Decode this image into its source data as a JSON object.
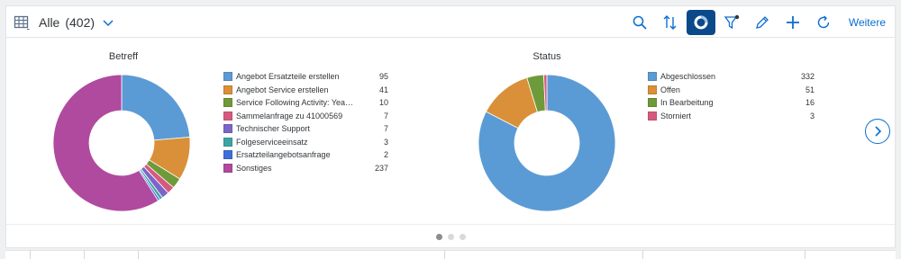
{
  "toolbar": {
    "view_title": "Alle",
    "view_count": "(402)",
    "more_label": "Weitere"
  },
  "icons": {
    "grid": "table-grid-icon",
    "chevron": "chevron-down-icon",
    "search": "search-icon",
    "sort": "sort-icon",
    "chart": "donut-chart-icon",
    "filter": "filter-icon",
    "edit": "pencil-icon",
    "add": "plus-icon",
    "refresh": "refresh-icon",
    "next": "chevron-right-icon"
  },
  "colors": {
    "accent": "#0a6ed1",
    "active_button": "#0a4a8a"
  },
  "chart_data": [
    {
      "type": "pie",
      "title": "Betreff",
      "categories": [
        "Angebot Ersatzteile erstellen",
        "Angebot Service erstellen",
        "Service Following Activity: Yea…",
        "Sammelanfrage zu 41000569",
        "Technischer Support",
        "Folgeserviceeinsatz",
        "Ersatzteilangebotsanfrage",
        "Sonstiges"
      ],
      "values": [
        95,
        41,
        10,
        7,
        7,
        3,
        2,
        237
      ],
      "display_values": [
        "95",
        "41",
        "10",
        "7",
        "7",
        "3",
        "2",
        "237"
      ],
      "colors": [
        "#5b9bd5",
        "#d99038",
        "#6f9a3a",
        "#d65a7f",
        "#7b66c8",
        "#3fa3a3",
        "#3e6fd8",
        "#b04a9e"
      ],
      "legend_position": "right"
    },
    {
      "type": "pie",
      "title": "Status",
      "categories": [
        "Abgeschlossen",
        "Offen",
        "In Bearbeitung",
        "Storniert"
      ],
      "values": [
        332,
        51,
        16,
        3
      ],
      "display_values": [
        "332",
        "51",
        "16",
        "3"
      ],
      "colors": [
        "#5b9bd5",
        "#d99038",
        "#6f9a3a",
        "#d65a7f"
      ],
      "legend_position": "right"
    }
  ],
  "pagination": {
    "pages": 3,
    "active": 0
  }
}
